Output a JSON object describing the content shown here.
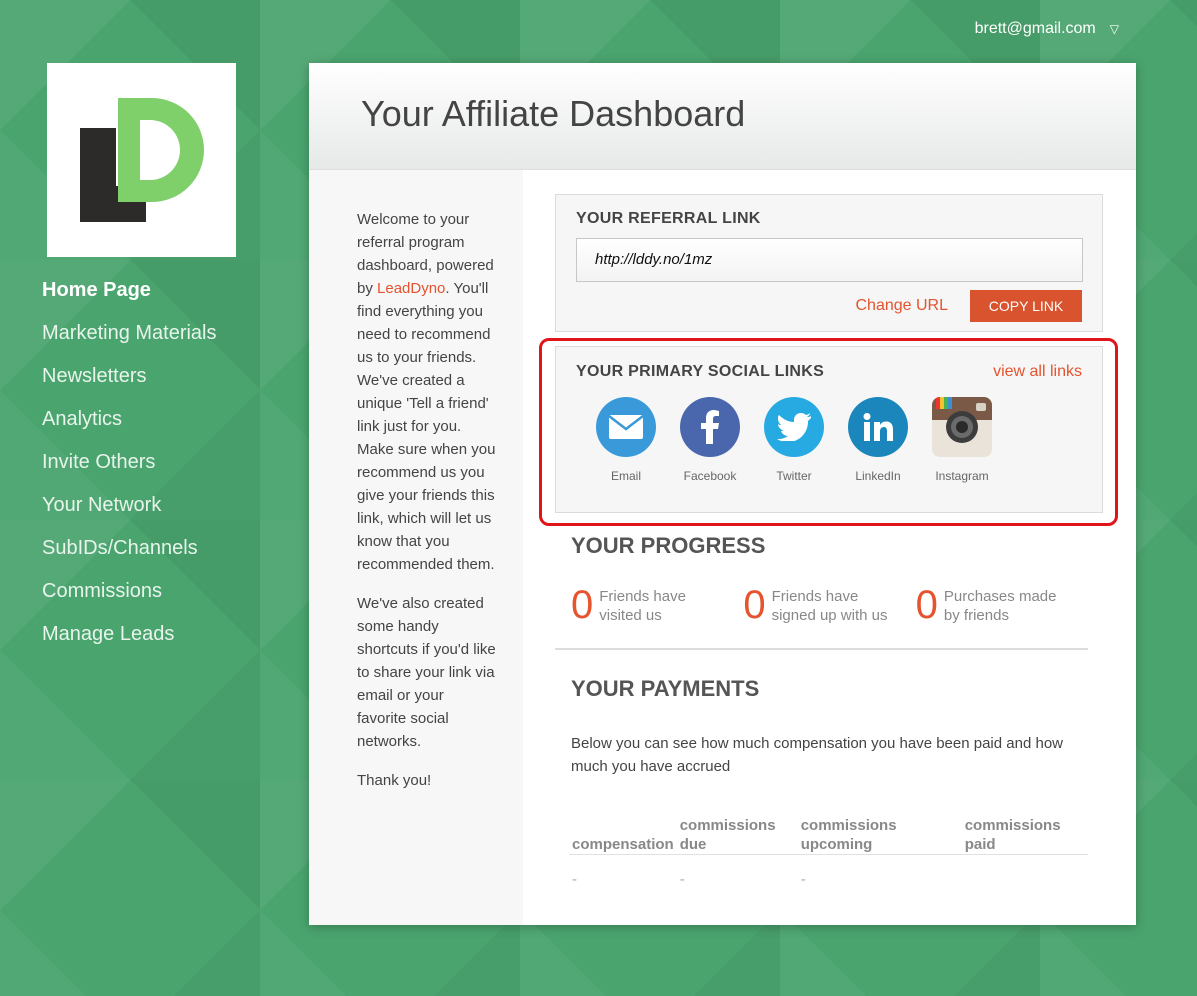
{
  "user": {
    "email": "brett@gmail.com",
    "caret": "▽"
  },
  "sidebar": {
    "items": [
      {
        "label": "Home Page"
      },
      {
        "label": "Marketing Materials"
      },
      {
        "label": "Newsletters"
      },
      {
        "label": "Analytics"
      },
      {
        "label": "Invite Others"
      },
      {
        "label": "Your Network"
      },
      {
        "label": "SubIDs/Channels"
      },
      {
        "label": "Commissions"
      },
      {
        "label": "Manage Leads"
      }
    ]
  },
  "header": {
    "title": "Your Affiliate Dashboard"
  },
  "intro": {
    "p1_before": "Welcome to your referral program dashboard, powered by ",
    "p1_link": "LeadDyno",
    "p1_after": ". You'll find everything you need to recommend us to your friends. We've created a unique 'Tell a friend' link just for you. Make sure when you recommend us you give your friends this link, which will let us know that you recommended them.",
    "p2": "We've also created some handy shortcuts if you'd like to share your link via email or your favorite social networks.",
    "p3": "Thank you!"
  },
  "referral": {
    "title": "YOUR REFERRAL LINK",
    "url": "http://lddy.no/1mz",
    "change_url": "Change URL",
    "copy_link": "COPY LINK"
  },
  "social": {
    "title": "YOUR PRIMARY SOCIAL LINKS",
    "view_all": "view all links",
    "items": [
      {
        "label": "Email",
        "icon": "email-icon",
        "color": "#3a9ad9"
      },
      {
        "label": "Facebook",
        "icon": "facebook-icon",
        "color": "#4a67ad"
      },
      {
        "label": "Twitter",
        "icon": "twitter-icon",
        "color": "#27aae1"
      },
      {
        "label": "LinkedIn",
        "icon": "linkedin-icon",
        "color": "#1b86bc"
      },
      {
        "label": "Instagram",
        "icon": "instagram-icon",
        "color": "#8b6a55"
      }
    ]
  },
  "progress": {
    "title": "YOUR PROGRESS",
    "stats": [
      {
        "num": "0",
        "l1": "Friends have",
        "l2": "visited us"
      },
      {
        "num": "0",
        "l1": "Friends have",
        "l2": "signed up with us"
      },
      {
        "num": "0",
        "l1": "Purchases made",
        "l2": "by friends"
      }
    ]
  },
  "payments": {
    "title": "YOUR PAYMENTS",
    "text": "Below you can see how much compensation you have been paid and how much you have accrued",
    "columns": [
      {
        "l1": "compensation",
        "l2": ""
      },
      {
        "l1": "commissions",
        "l2": "due"
      },
      {
        "l1": "commissions",
        "l2": "upcoming"
      },
      {
        "l1": "commissions",
        "l2": "paid"
      }
    ],
    "row": [
      "-",
      "-",
      "-",
      ""
    ]
  },
  "colors": {
    "accent": "#e5532f",
    "background": "#4aa46e",
    "highlight": "#e0151a"
  }
}
